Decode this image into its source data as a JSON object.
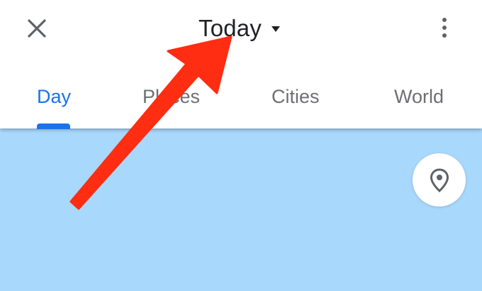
{
  "header": {
    "title": "Today",
    "close_icon": "close-icon",
    "dropdown_icon": "dropdown-caret-icon",
    "more_icon": "more-vertical-icon"
  },
  "tabs": [
    {
      "label": "Day",
      "active": true
    },
    {
      "label": "Places",
      "active": false
    },
    {
      "label": "Cities",
      "active": false
    },
    {
      "label": "World",
      "active": false
    }
  ],
  "map": {
    "background_color": "#a9d8fd",
    "location_icon": "map-pin-icon"
  },
  "annotation": {
    "arrow_color": "#ff2d12"
  },
  "colors": {
    "accent": "#1a73e8",
    "tab_inactive": "#6e6f72",
    "title": "#202124"
  }
}
